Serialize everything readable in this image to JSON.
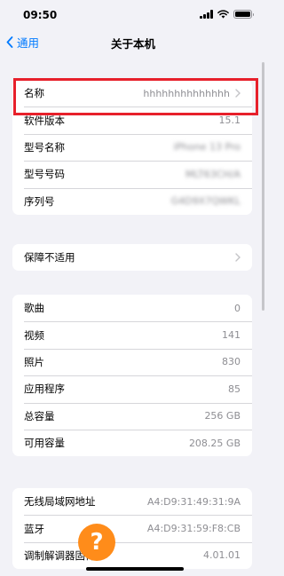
{
  "status_bar": {
    "time": "09:50"
  },
  "nav": {
    "back_label": "通用",
    "title": "关于本机"
  },
  "group1": [
    {
      "label": "名称",
      "value": "hhhhhhhhhhhhhh",
      "chevron": true
    },
    {
      "label": "软件版本",
      "value": "15.1"
    },
    {
      "label": "型号名称",
      "value": "iPhone 13 Pro",
      "blurred": true
    },
    {
      "label": "型号号码",
      "value": "MLT63CH/A",
      "blurred": true
    },
    {
      "label": "序列号",
      "value": "G4D9X7QWKL",
      "blurred": true
    }
  ],
  "warranty": {
    "label": "保障不适用"
  },
  "group2": [
    {
      "label": "歌曲",
      "value": "0"
    },
    {
      "label": "视频",
      "value": "141"
    },
    {
      "label": "照片",
      "value": "830"
    },
    {
      "label": "应用程序",
      "value": "85"
    },
    {
      "label": "总容量",
      "value": "256 GB"
    },
    {
      "label": "可用容量",
      "value": "208.25 GB"
    }
  ],
  "group3": [
    {
      "label": "无线局域网地址",
      "value": "A4:D9:31:49:31:9A"
    },
    {
      "label": "蓝牙",
      "value": "A4:D9:31:59:F8:CB"
    },
    {
      "label": "调制解调器固件",
      "value": "4.01.01"
    }
  ],
  "help": {
    "symbol": "?"
  },
  "colors": {
    "accent": "#007aff",
    "highlight": "#e7202b",
    "help": "#ff8c1a"
  }
}
